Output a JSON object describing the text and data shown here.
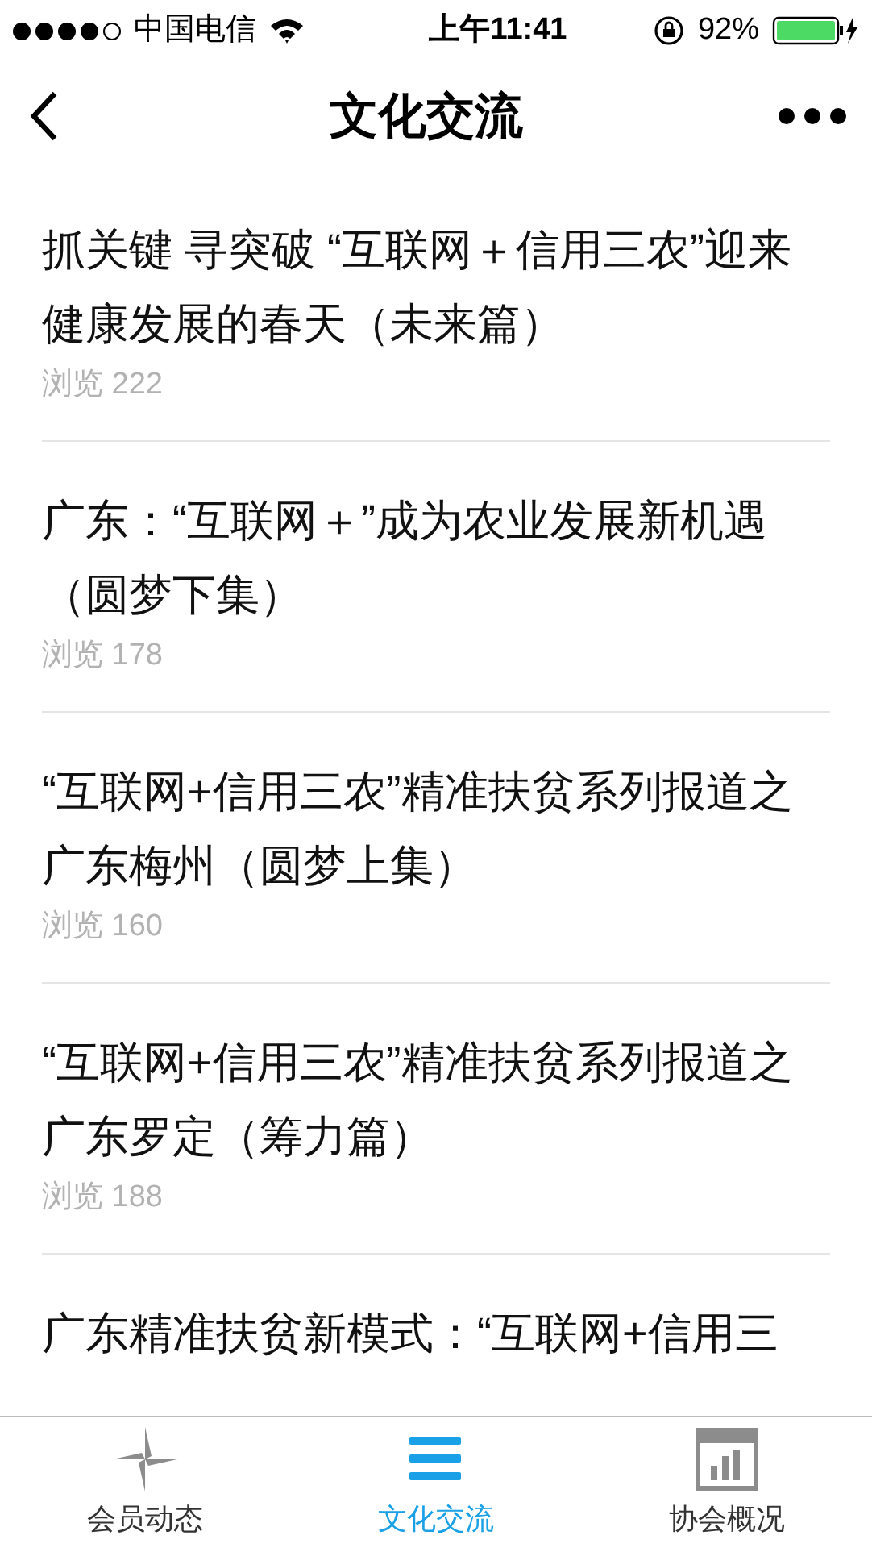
{
  "status_bar": {
    "carrier": "中国电信",
    "time": "上午11:41",
    "battery": "92%"
  },
  "nav": {
    "title": "文化交流"
  },
  "articles": [
    {
      "title": "抓关键 寻突破 “互联网＋信用三农”迎来健康发展的春天（未来篇）",
      "views": "浏览 222"
    },
    {
      "title": "广东：“互联网＋”成为农业发展新机遇（圆梦下集）",
      "views": "浏览 178"
    },
    {
      "title": "“互联网+信用三农”精准扶贫系列报道之广东梅州（圆梦上集）",
      "views": "浏览 160"
    },
    {
      "title": "“互联网+信用三农”精准扶贫系列报道之广东罗定（筹力篇）",
      "views": "浏览 188"
    },
    {
      "title": "广东精准扶贫新模式：“互联网+信用三"
    }
  ],
  "tabs": [
    {
      "label": "会员动态",
      "selected": false,
      "kind": "pinwheel"
    },
    {
      "label": "文化交流",
      "selected": true,
      "kind": "list"
    },
    {
      "label": "协会概况",
      "selected": false,
      "kind": "chart"
    }
  ]
}
